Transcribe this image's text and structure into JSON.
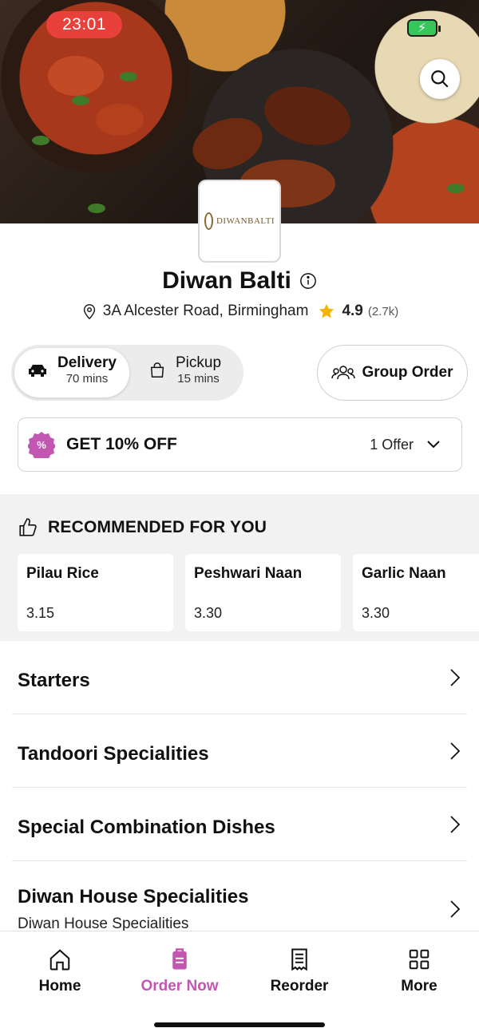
{
  "status_bar": {
    "time": "23:01"
  },
  "restaurant": {
    "logo_text": "DIWANBALTI",
    "name": "Diwan Balti",
    "address": "3A Alcester Road, Birmingham",
    "rating": "4.9",
    "reviews": "(2.7k)"
  },
  "order_mode": {
    "delivery": {
      "label": "Delivery",
      "time": "70 mins"
    },
    "pickup": {
      "label": "Pickup",
      "time": "15 mins"
    },
    "group_order_label": "Group Order"
  },
  "offer": {
    "title": "GET 10% OFF",
    "count": "1 Offer"
  },
  "recommended": {
    "heading": "RECOMMENDED FOR YOU",
    "items": [
      {
        "name": "Pilau Rice",
        "price": "3.15"
      },
      {
        "name": "Peshwari Naan",
        "price": "3.30"
      },
      {
        "name": "Garlic Naan",
        "price": "3.30"
      }
    ]
  },
  "categories": [
    {
      "title": "Starters",
      "subtitle": ""
    },
    {
      "title": "Tandoori Specialities",
      "subtitle": ""
    },
    {
      "title": "Special Combination Dishes",
      "subtitle": ""
    },
    {
      "title": "Diwan House Specialities",
      "subtitle": "Diwan House Specialities"
    }
  ],
  "tabs": [
    {
      "label": "Home",
      "icon": "home-icon"
    },
    {
      "label": "Order Now",
      "icon": "order-bag-icon"
    },
    {
      "label": "Reorder",
      "icon": "receipt-icon"
    },
    {
      "label": "More",
      "icon": "grid-icon"
    }
  ],
  "colors": {
    "accent": "#c257b1",
    "time_pill": "#e8403a",
    "rating_star": "#f4b400"
  }
}
